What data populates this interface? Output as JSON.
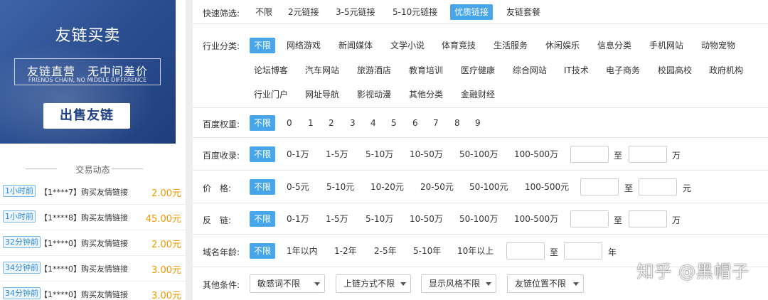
{
  "banner": {
    "title": "友链买卖",
    "subtitle": "友链直营　无中间差价",
    "subtitle_en": "FRIENDS CHAIN, NO MIDDLE DIFFERENCE",
    "sell_button": "出售友链"
  },
  "trades": {
    "heading": "交易动态",
    "items": [
      {
        "time": "1小时前",
        "text": "【1****7】购买友情链接",
        "price": "2.00元"
      },
      {
        "time": "1小时前",
        "text": "【1****8】购买友情链接",
        "price": "45.00元"
      },
      {
        "time": "32分钟前",
        "text": "【1****0】购买友情链接",
        "price": "2.00元"
      },
      {
        "time": "34分钟前",
        "text": "【1****0】购买友情链接",
        "price": "3.00元"
      },
      {
        "time": "34分钟前",
        "text": "【1****0】购买友情链接",
        "price": "3.00元"
      }
    ]
  },
  "filters": {
    "quick": {
      "label": "快速筛选:",
      "options": [
        "不限",
        "2元链接",
        "3-5元链接",
        "5-10元链接",
        "优质链接",
        "友链套餐"
      ]
    },
    "industry": {
      "label": "行业分类:",
      "options": [
        "不限",
        "网络游戏",
        "新闻媒体",
        "文学小说",
        "体育竞技",
        "生活服务",
        "休闲娱乐",
        "信息分类",
        "手机网站",
        "动物宠物",
        "论坛博客",
        "汽车网站",
        "旅游酒店",
        "教育培训",
        "医疗健康",
        "综合网站",
        "IT技术",
        "电子商务",
        "校园高校",
        "政府机构",
        "行业门户",
        "网址导航",
        "影视动漫",
        "其他分类",
        "金融财经"
      ]
    },
    "weight": {
      "label": "百度权重:",
      "options": [
        "不限",
        "0",
        "1",
        "2",
        "3",
        "4",
        "5",
        "6",
        "7",
        "8",
        "9"
      ]
    },
    "indexed": {
      "label": "百度收录:",
      "options": [
        "不限",
        "0-1万",
        "1-5万",
        "5-10万",
        "10-50万",
        "50-100万",
        "100-500万"
      ],
      "to": "至",
      "unit": "万"
    },
    "price": {
      "label": "价　格:",
      "options": [
        "不限",
        "0-5元",
        "5-10元",
        "10-20元",
        "20-50元",
        "50-100元",
        "100-500元"
      ],
      "to": "至",
      "unit": "元"
    },
    "backlinks": {
      "label": "反　链:",
      "options": [
        "不限",
        "0-1万",
        "1-5万",
        "5-10万",
        "10-50万",
        "50-100万",
        "100-500万"
      ],
      "to": "至",
      "unit": "万"
    },
    "domain_age": {
      "label": "域名年龄:",
      "options": [
        "不限",
        "1年以内",
        "1-2年",
        "2-5年",
        "5-10年",
        "10年以上"
      ],
      "to": "至",
      "unit": "年"
    },
    "other": {
      "label": "其他条件:",
      "selects": [
        "敏感词不限",
        "上链方式不限",
        "显示风格不限",
        "友链位置不限"
      ]
    }
  },
  "watermark": "知乎 @黑帽子",
  "colors": {
    "accent": "#46a6e9",
    "price": "#f39800",
    "banner": "#2c4f91"
  }
}
